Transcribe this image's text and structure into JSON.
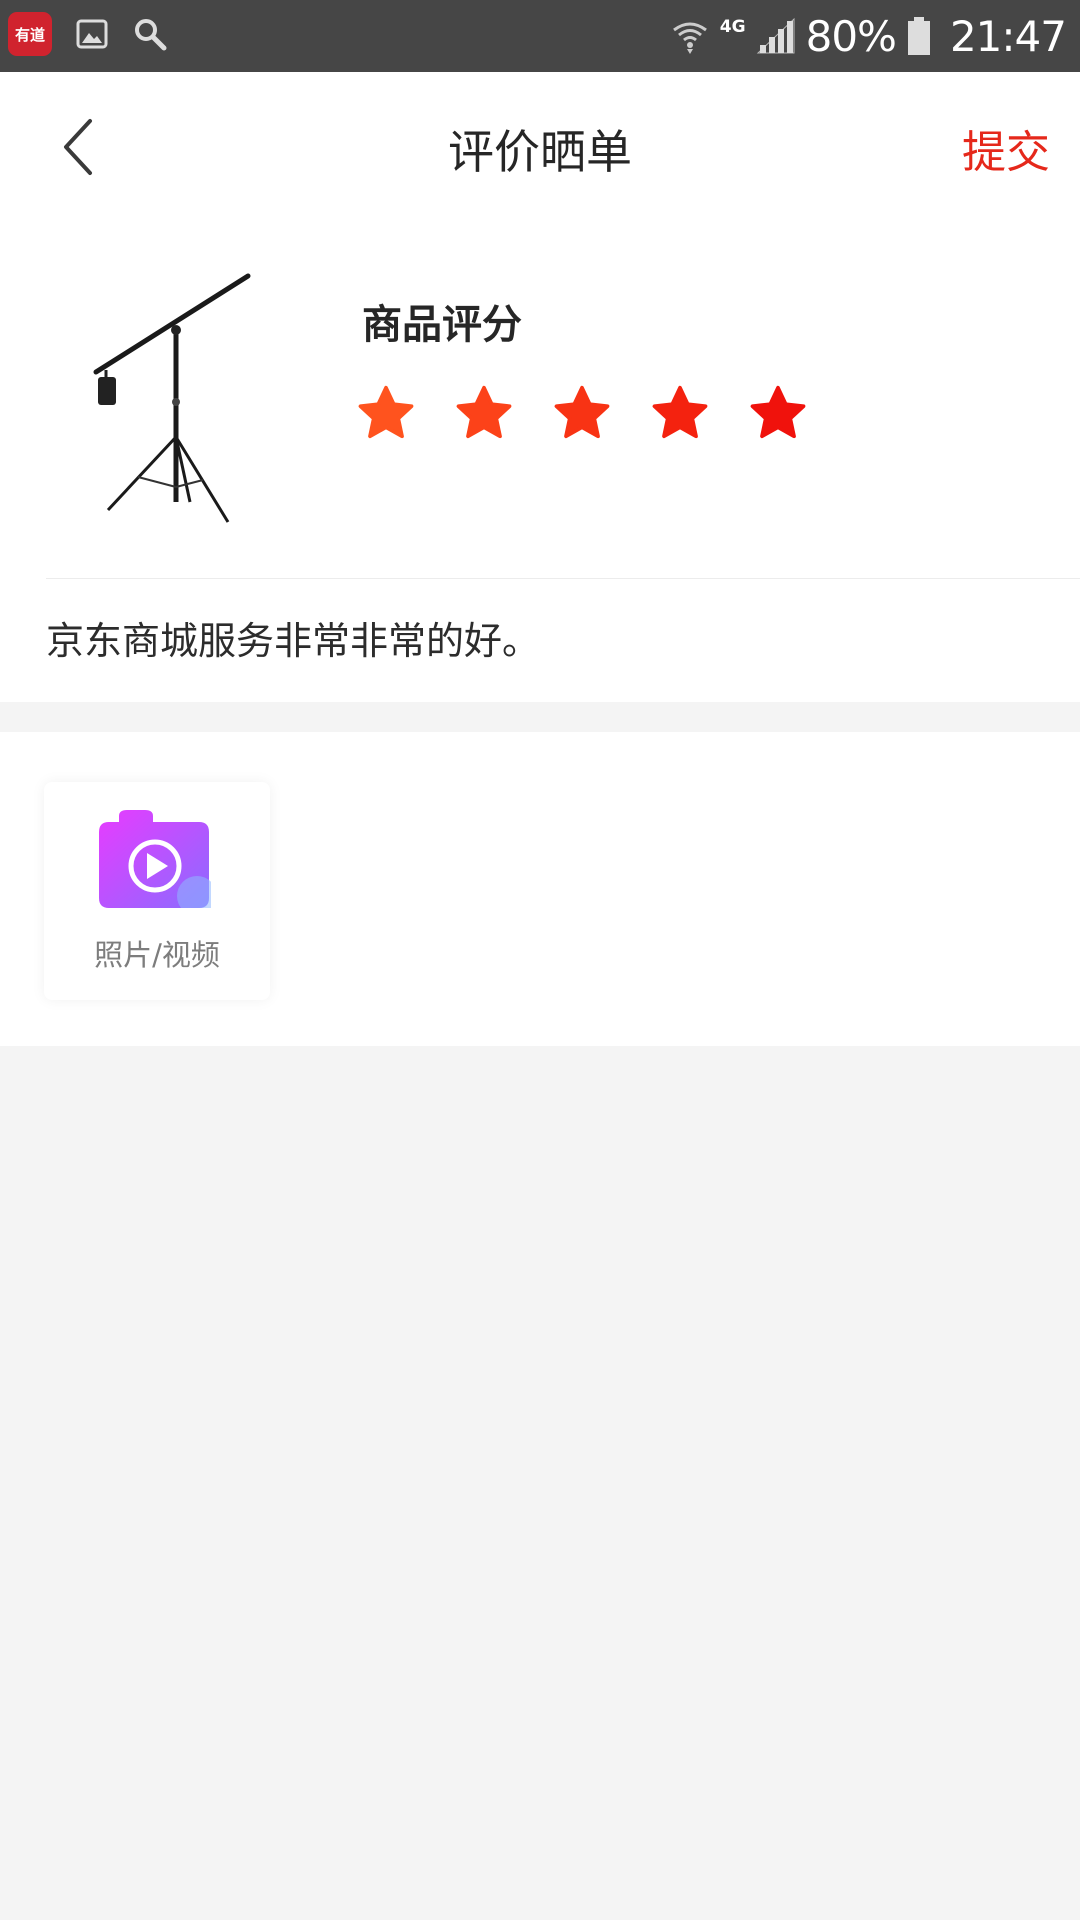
{
  "status_bar": {
    "app_badge": "有道",
    "network": "4G",
    "battery": "80%",
    "time": "21:47"
  },
  "header": {
    "title": "评价晒单",
    "submit_label": "提交"
  },
  "product": {
    "score_title": "商品评分",
    "rating": 5,
    "max_rating": 5,
    "review_text": "京东商城服务非常非常的好。"
  },
  "media": {
    "upload_label": "照片/视频"
  },
  "colors": {
    "accent": "#e5281b",
    "star_start": "#ff5a1f",
    "star_end": "#f0120c"
  }
}
